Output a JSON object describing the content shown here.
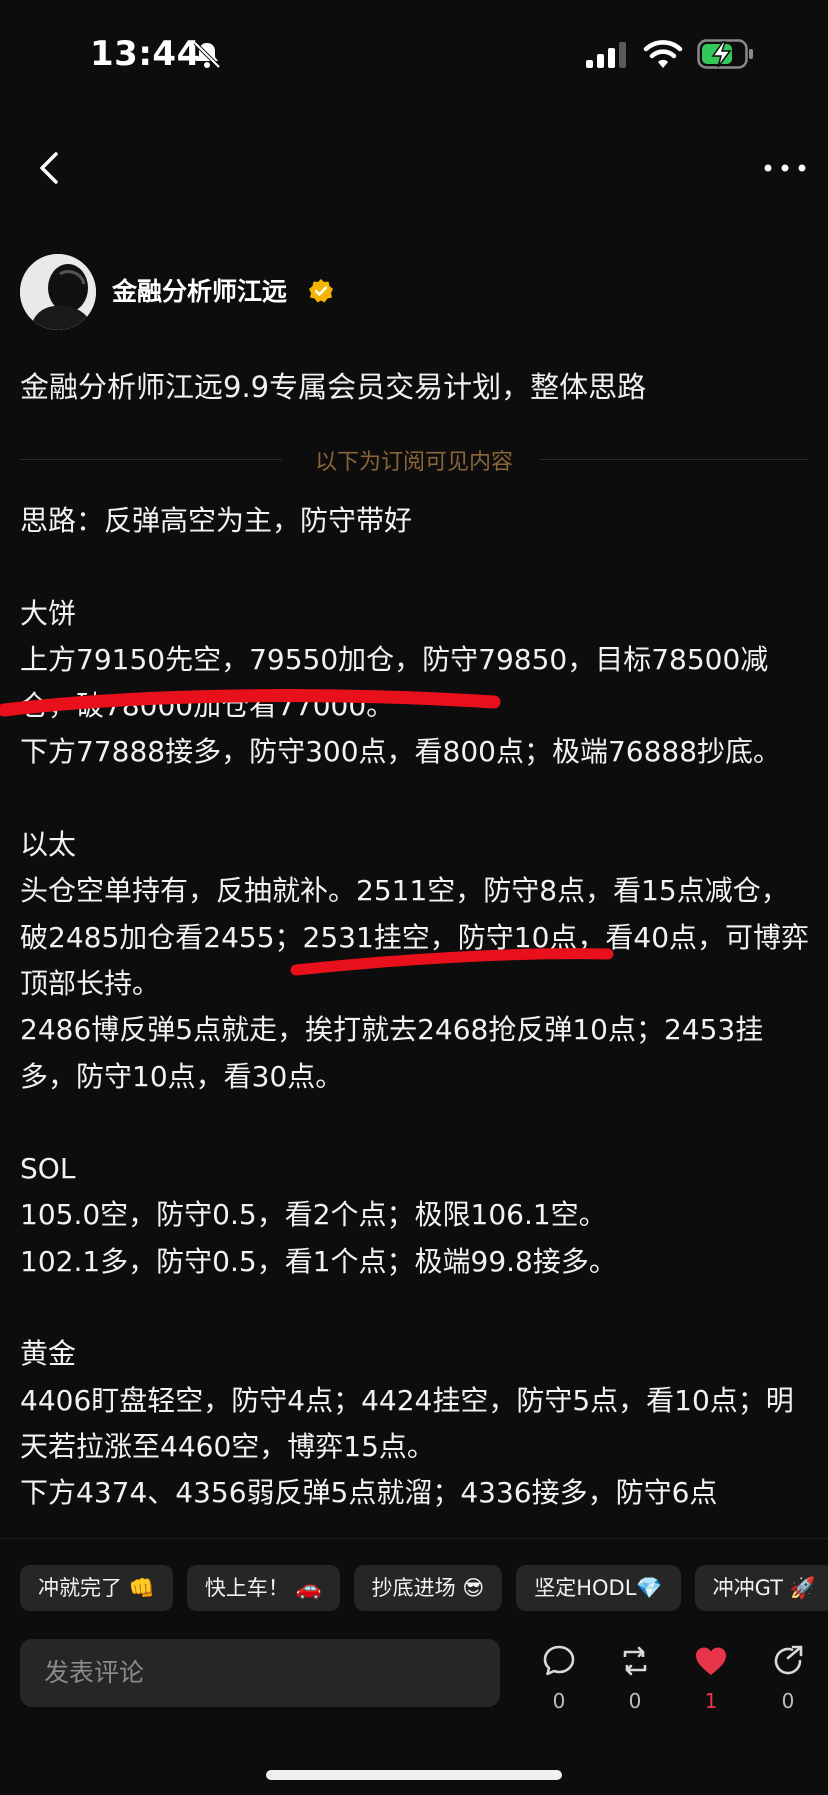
{
  "status_bar": {
    "time": "13:44",
    "icons": [
      "bell-slash-icon",
      "cellular-signal-icon",
      "wifi-icon",
      "battery-charging-icon"
    ]
  },
  "nav": {
    "back_icon": "chevron-left-icon",
    "more_icon": "more-dots-icon"
  },
  "author": {
    "name": "金融分析师江远",
    "verified_icon": "verified-badge-icon",
    "verified_color": "#f5b400"
  },
  "post": {
    "title": "金融分析师江远9.9专属会员交易计划，整体思路",
    "paywall_divider": "以下为订阅可见内容",
    "paywall_color": "#8a6538",
    "lines": [
      "思路：反弹高空为主，防守带好",
      "",
      "大饼",
      "上方79150先空，79550加仓，防守79850，目标78500减仓，破78000加仓看77000。",
      "下方77888接多，防守300点，看800点；极端76888抄底。",
      "",
      "以太",
      "头仓空单持有，反抽就补。2511空，防守8点，看15点减仓，破2485加仓看2455；2531挂空，防守10点，看40点，可博弈顶部长持。",
      "2486博反弹5点就走，挨打就去2468抢反弹10点；2453挂多，防守10点，看30点。",
      "",
      "SOL",
      "105.0空，防守0.5，看2个点；极限106.1空。",
      "102.1多，防守0.5，看1个点；极端99.8接多。",
      "",
      "黄金",
      "4406盯盘轻空，防守4点；4424挂空，防守5点，看10点；明天若拉涨至4460空，博弈15点。",
      "下方4374、4356弱反弹5点就溜；4336接多，防守6点"
    ],
    "annotation_color": "#e8101a"
  },
  "quick_replies": [
    "冲就完了 👊",
    "快上车！ 🚗",
    "抄底进场 😎",
    "坚定HODL💎",
    "冲冲GT 🚀"
  ],
  "comment": {
    "placeholder": "发表评论"
  },
  "actions": {
    "comment": {
      "icon": "comment-bubble-icon",
      "count": "0"
    },
    "repost": {
      "icon": "repost-icon",
      "count": "0"
    },
    "like": {
      "icon": "heart-icon",
      "count": "1",
      "color": "#e8344a"
    },
    "share": {
      "icon": "share-arrow-icon",
      "count": "0"
    }
  }
}
